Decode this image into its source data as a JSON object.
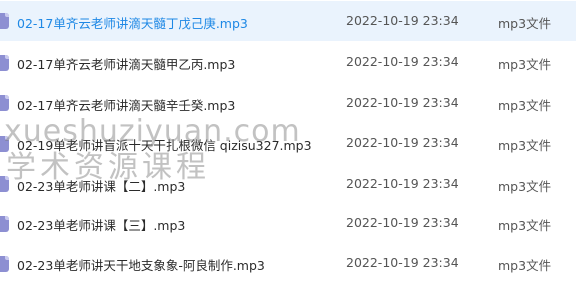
{
  "files": [
    {
      "name": "02-17单齐云老师讲滴天髓丁戊己庚.mp3",
      "date": "2022-10-19 23:34",
      "type": "mp3文件",
      "selected": true,
      "icon": "mp3-file-icon"
    },
    {
      "name": "02-17单齐云老师讲滴天髓甲乙丙.mp3",
      "date": "2022-10-19 23:34",
      "type": "mp3文件",
      "selected": false,
      "icon": "mp3-file-icon"
    },
    {
      "name": "02-17单齐云老师讲滴天髓辛壬癸.mp3",
      "date": "2022-10-19 23:34",
      "type": "mp3文件",
      "selected": false,
      "icon": "mp3-file-icon"
    },
    {
      "name": "02-19单老师讲盲派十天干扎根微信 qizisu327.mp3",
      "date": "2022-10-19 23:34",
      "type": "mp3文件",
      "selected": false,
      "icon": "mp3-file-icon"
    },
    {
      "name": "02-23单老师讲课【二】.mp3",
      "date": "2022-10-19 23:34",
      "type": "mp3文件",
      "selected": false,
      "icon": "mp3-file-icon"
    },
    {
      "name": "02-23单老师讲课【三】.mp3",
      "date": "2022-10-19 23:34",
      "type": "mp3文件",
      "selected": false,
      "icon": "mp3-file-icon"
    },
    {
      "name": "02-23单老师讲天干地支象象-阿良制作.mp3",
      "date": "2022-10-19 23:34",
      "type": "mp3文件",
      "selected": false,
      "icon": "mp3-file-icon"
    }
  ],
  "watermark": {
    "url": "xueshuziyuan.com",
    "text": "学术资源课程"
  },
  "colors": {
    "selected_bg": "#eaf3fd",
    "selected_text": "#1e88e5",
    "icon": "#8d8fd2"
  }
}
